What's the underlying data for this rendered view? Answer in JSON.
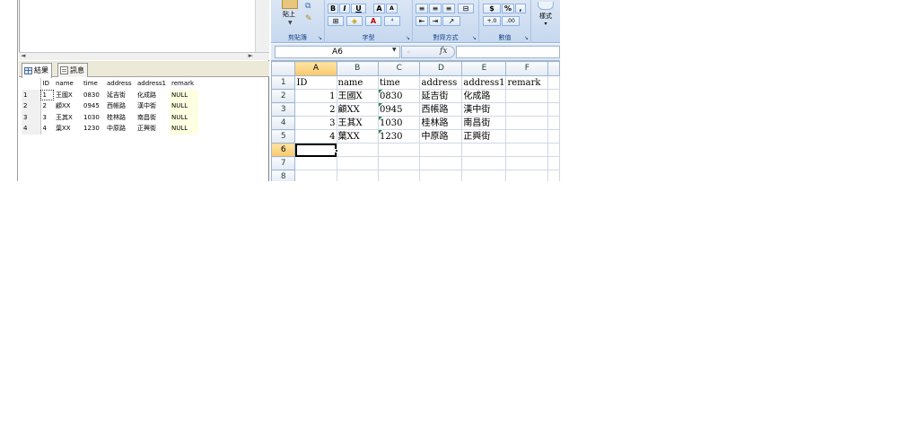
{
  "sql": {
    "tabs": [
      {
        "label": "結果",
        "icon": "grid-icon",
        "active": true
      },
      {
        "label": "訊息",
        "icon": "message-icon",
        "active": false
      }
    ],
    "columns": [
      "ID",
      "name",
      "time",
      "address",
      "address1",
      "remark"
    ],
    "rows": [
      {
        "rownum": "1",
        "id": "1",
        "name": "王國X",
        "time": "0830",
        "address": "延吉街",
        "address1": "化成路",
        "remark": "NULL"
      },
      {
        "rownum": "2",
        "id": "2",
        "name": "顧XX",
        "time": "0945",
        "address": "西帳路",
        "address1": "漢中街",
        "remark": "NULL"
      },
      {
        "rownum": "3",
        "id": "3",
        "name": "王其X",
        "time": "1030",
        "address": "桂林路",
        "address1": "南昌街",
        "remark": "NULL"
      },
      {
        "rownum": "4",
        "id": "4",
        "name": "葉XX",
        "time": "1230",
        "address": "中原路",
        "address1": "正興街",
        "remark": "NULL"
      }
    ]
  },
  "excel": {
    "ribbon": {
      "clipboard": {
        "label": "剪貼簿",
        "paste_label": "貼上"
      },
      "font": {
        "label": "字型",
        "bold": "B",
        "italic": "I",
        "underline": "U",
        "grow": "A",
        "shrink": "A"
      },
      "alignment": {
        "label": "對齊方式"
      },
      "number": {
        "label": "數值",
        "currency": "$",
        "percent": "%",
        "comma": ",",
        "increase_decimal": "+.0",
        "decrease_decimal": ".00"
      },
      "styles": {
        "label": "樣式"
      }
    },
    "name_box": "A6",
    "fx_label": "fx",
    "formula": "",
    "columns": [
      "A",
      "B",
      "C",
      "D",
      "E",
      "F"
    ],
    "highlight_column": "A",
    "row_numbers": [
      "1",
      "2",
      "3",
      "4",
      "5",
      "6",
      "7",
      "8"
    ],
    "highlight_row": "6",
    "cells": [
      [
        "ID",
        "name",
        "time",
        "address",
        "address1",
        "remark"
      ],
      [
        "1",
        "王國X",
        "0830",
        "延吉街",
        "化成路",
        ""
      ],
      [
        "2",
        "顧XX",
        "0945",
        "西帳路",
        "漢中街",
        ""
      ],
      [
        "3",
        "王其X",
        "1030",
        "桂林路",
        "南昌街",
        ""
      ],
      [
        "4",
        "葉XX",
        "1230",
        "中原路",
        "正興街",
        ""
      ],
      [
        "",
        "",
        "",
        "",
        "",
        ""
      ],
      [
        "",
        "",
        "",
        "",
        "",
        ""
      ],
      [
        "",
        "",
        "",
        "",
        "",
        ""
      ]
    ]
  }
}
